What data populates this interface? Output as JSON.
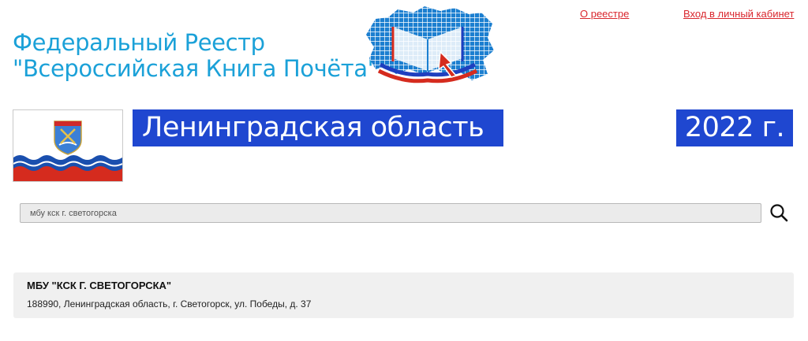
{
  "header": {
    "title_line1": "Федеральный Реестр",
    "title_line2": "\"Всероссийская Книга Почёта\"",
    "link_about": "О реестре",
    "link_login": "Вход в личный кабинет"
  },
  "region": {
    "name": "Ленинградская область",
    "year": "2022 г."
  },
  "search": {
    "value": "мбу кск г. светогорска",
    "icon": "search-icon"
  },
  "results": [
    {
      "name": "МБУ \"КСК Г. СВЕТОГОРСКА\"",
      "address": "188990, Ленинградская область, г. Светогорск, ул. Победы, д. 37"
    }
  ],
  "colors": {
    "title": "#1ba1d8",
    "link": "#d9262d",
    "banner": "#1f47d0",
    "flag_blue": "#1a4fae",
    "flag_red": "#d52b1e"
  }
}
